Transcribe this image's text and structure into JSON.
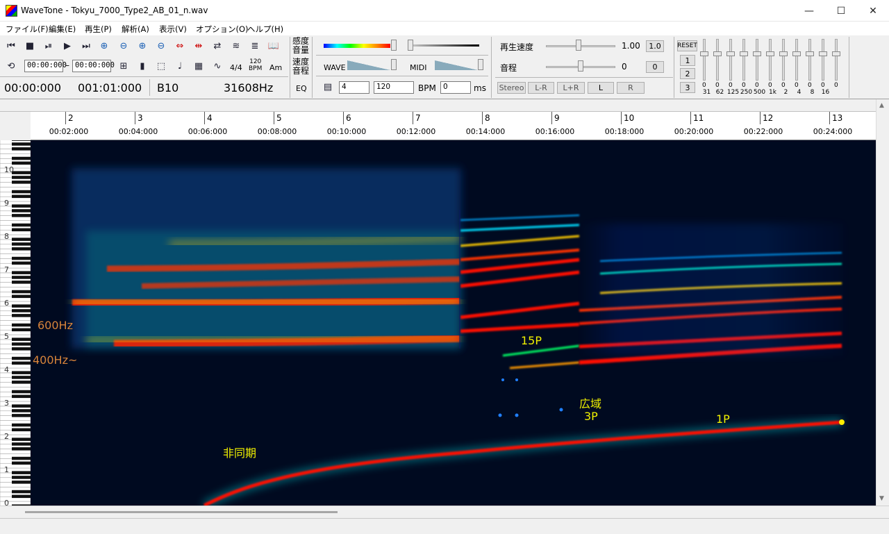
{
  "window": {
    "title": "WaveTone - Tokyu_7000_Type2_AB_01_n.wav",
    "minimize": "—",
    "maximize": "☐",
    "close": "✕"
  },
  "menu": [
    "ファイル(F)",
    "編集(E)",
    "再生(P)",
    "解析(A)",
    "表示(V)",
    "オプション(O)",
    "ヘルプ(H)"
  ],
  "toolbar": {
    "range_start": "00:00:000",
    "range_dash": "–",
    "range_end": "00:00:000",
    "time_sig": "4/4",
    "bpm_icon_top": "120",
    "bpm_icon_bottom": "BPM",
    "chord_icon": "Am",
    "status_time": "00:00:000",
    "status_beat": "001:01:000",
    "status_note": "B10",
    "status_freq": "31608Hz",
    "sensitivity_label": "感度",
    "volume_label": "音量",
    "speed_label": "速度",
    "pitch_label": "音程",
    "eq_label": "EQ",
    "wave_label": "WAVE",
    "midi_label": "MIDI",
    "beat_value": "4",
    "bpm_value": "120",
    "bpm_label": "BPM",
    "ms_value": "0",
    "ms_label": "ms",
    "playback_speed_label": "再生速度",
    "playback_speed_value": "1.00",
    "playback_speed_button": "1.0",
    "pitch_shift_label": "音程",
    "pitch_shift_value": "0",
    "pitch_shift_button": "0",
    "stereo_label": "Stereo",
    "channel_buttons": [
      "L-R",
      "L+R",
      "L",
      "R"
    ],
    "eq_reset": "RESET",
    "eq_presets": [
      "1",
      "2",
      "3"
    ],
    "eq_band_values": [
      "0",
      "0",
      "0",
      "0",
      "0",
      "0",
      "0",
      "0",
      "0",
      "0",
      "0"
    ],
    "eq_band_freqs": [
      "31",
      "62",
      "125",
      "250",
      "500",
      "1k",
      "2",
      "4",
      "8",
      "16"
    ]
  },
  "ruler": {
    "bars": [
      "2",
      "3",
      "4",
      "5",
      "6",
      "7",
      "8",
      "9",
      "10",
      "11",
      "12",
      "13"
    ],
    "times": [
      "00:02:000",
      "00:04:000",
      "00:06:000",
      "00:08:000",
      "00:10:000",
      "00:12:000",
      "00:14:000",
      "00:16:000",
      "00:18:000",
      "00:20:000",
      "00:22:000",
      "00:24:000"
    ]
  },
  "octaves": [
    "10",
    "9",
    "8",
    "7",
    "6",
    "5",
    "4",
    "3",
    "2",
    "1",
    "0"
  ],
  "annotations": {
    "hz600": "600Hz",
    "hz400": "400Hz~",
    "p15": "15P",
    "wide": "広域",
    "p3": "3P",
    "p1": "1P",
    "async": "非同期"
  },
  "colors": {
    "annotation_orange": "#d8843a",
    "annotation_yellow": "#f0f000",
    "spectrogram_bg": "#000a20"
  }
}
